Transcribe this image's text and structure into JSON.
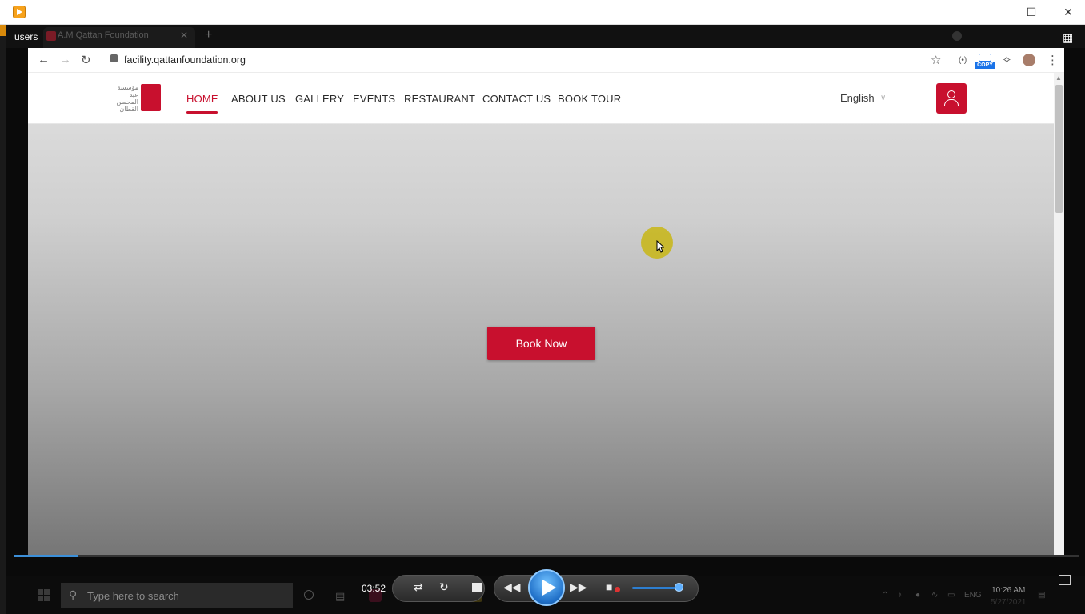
{
  "player": {
    "time": "03:52",
    "volume_fraction": 0.9,
    "progress_fraction": 0.06
  },
  "browser": {
    "playlist_label": "users",
    "tab_title": "A.M Qattan Foundation",
    "tab_close": "✕",
    "new_tab": "+",
    "url": "facility.qattanfoundation.org",
    "copy_ext_label": "COPY"
  },
  "site": {
    "logo_arabic": "مؤسسة عبد المحسن القطان",
    "nav": [
      "HOME",
      "ABOUT US",
      "GALLERY",
      "EVENTS",
      "RESTAURANT",
      "CONTACT US",
      "BOOK TOUR"
    ],
    "active_nav": "HOME",
    "language": "English",
    "cta": "Book Now",
    "accent": "#c8102e"
  },
  "taskbar": {
    "search_placeholder": "Type here to search",
    "lang": "ENG",
    "time": "10:26 AM",
    "date": "5/27/2021"
  },
  "icons": {
    "back": "arrow-left-icon",
    "forward": "arrow-right-icon",
    "reload": "reload-icon",
    "star": "star-icon",
    "extensions": "puzzle-icon",
    "menu": "kebab-menu-icon"
  }
}
